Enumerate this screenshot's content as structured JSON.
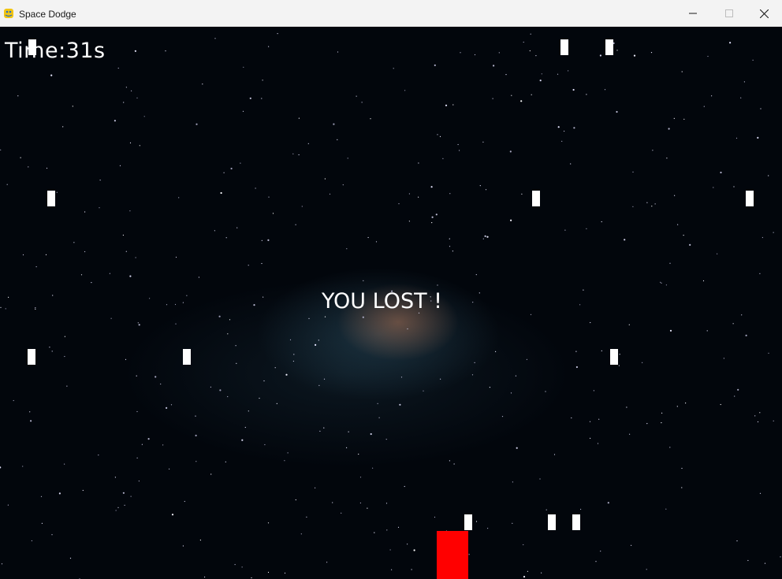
{
  "window": {
    "title": "Space Dodge",
    "icon": "pygame-snake-icon",
    "controls": [
      "minimize-icon",
      "maximize-icon",
      "close-icon"
    ]
  },
  "hud": {
    "time_text": "Time:31s"
  },
  "game_over": {
    "message": "YOU LOST !"
  },
  "colors": {
    "player": "#ff0000",
    "projectile": "#ffffff",
    "text": "#ffffff",
    "background": "#02060c"
  }
}
